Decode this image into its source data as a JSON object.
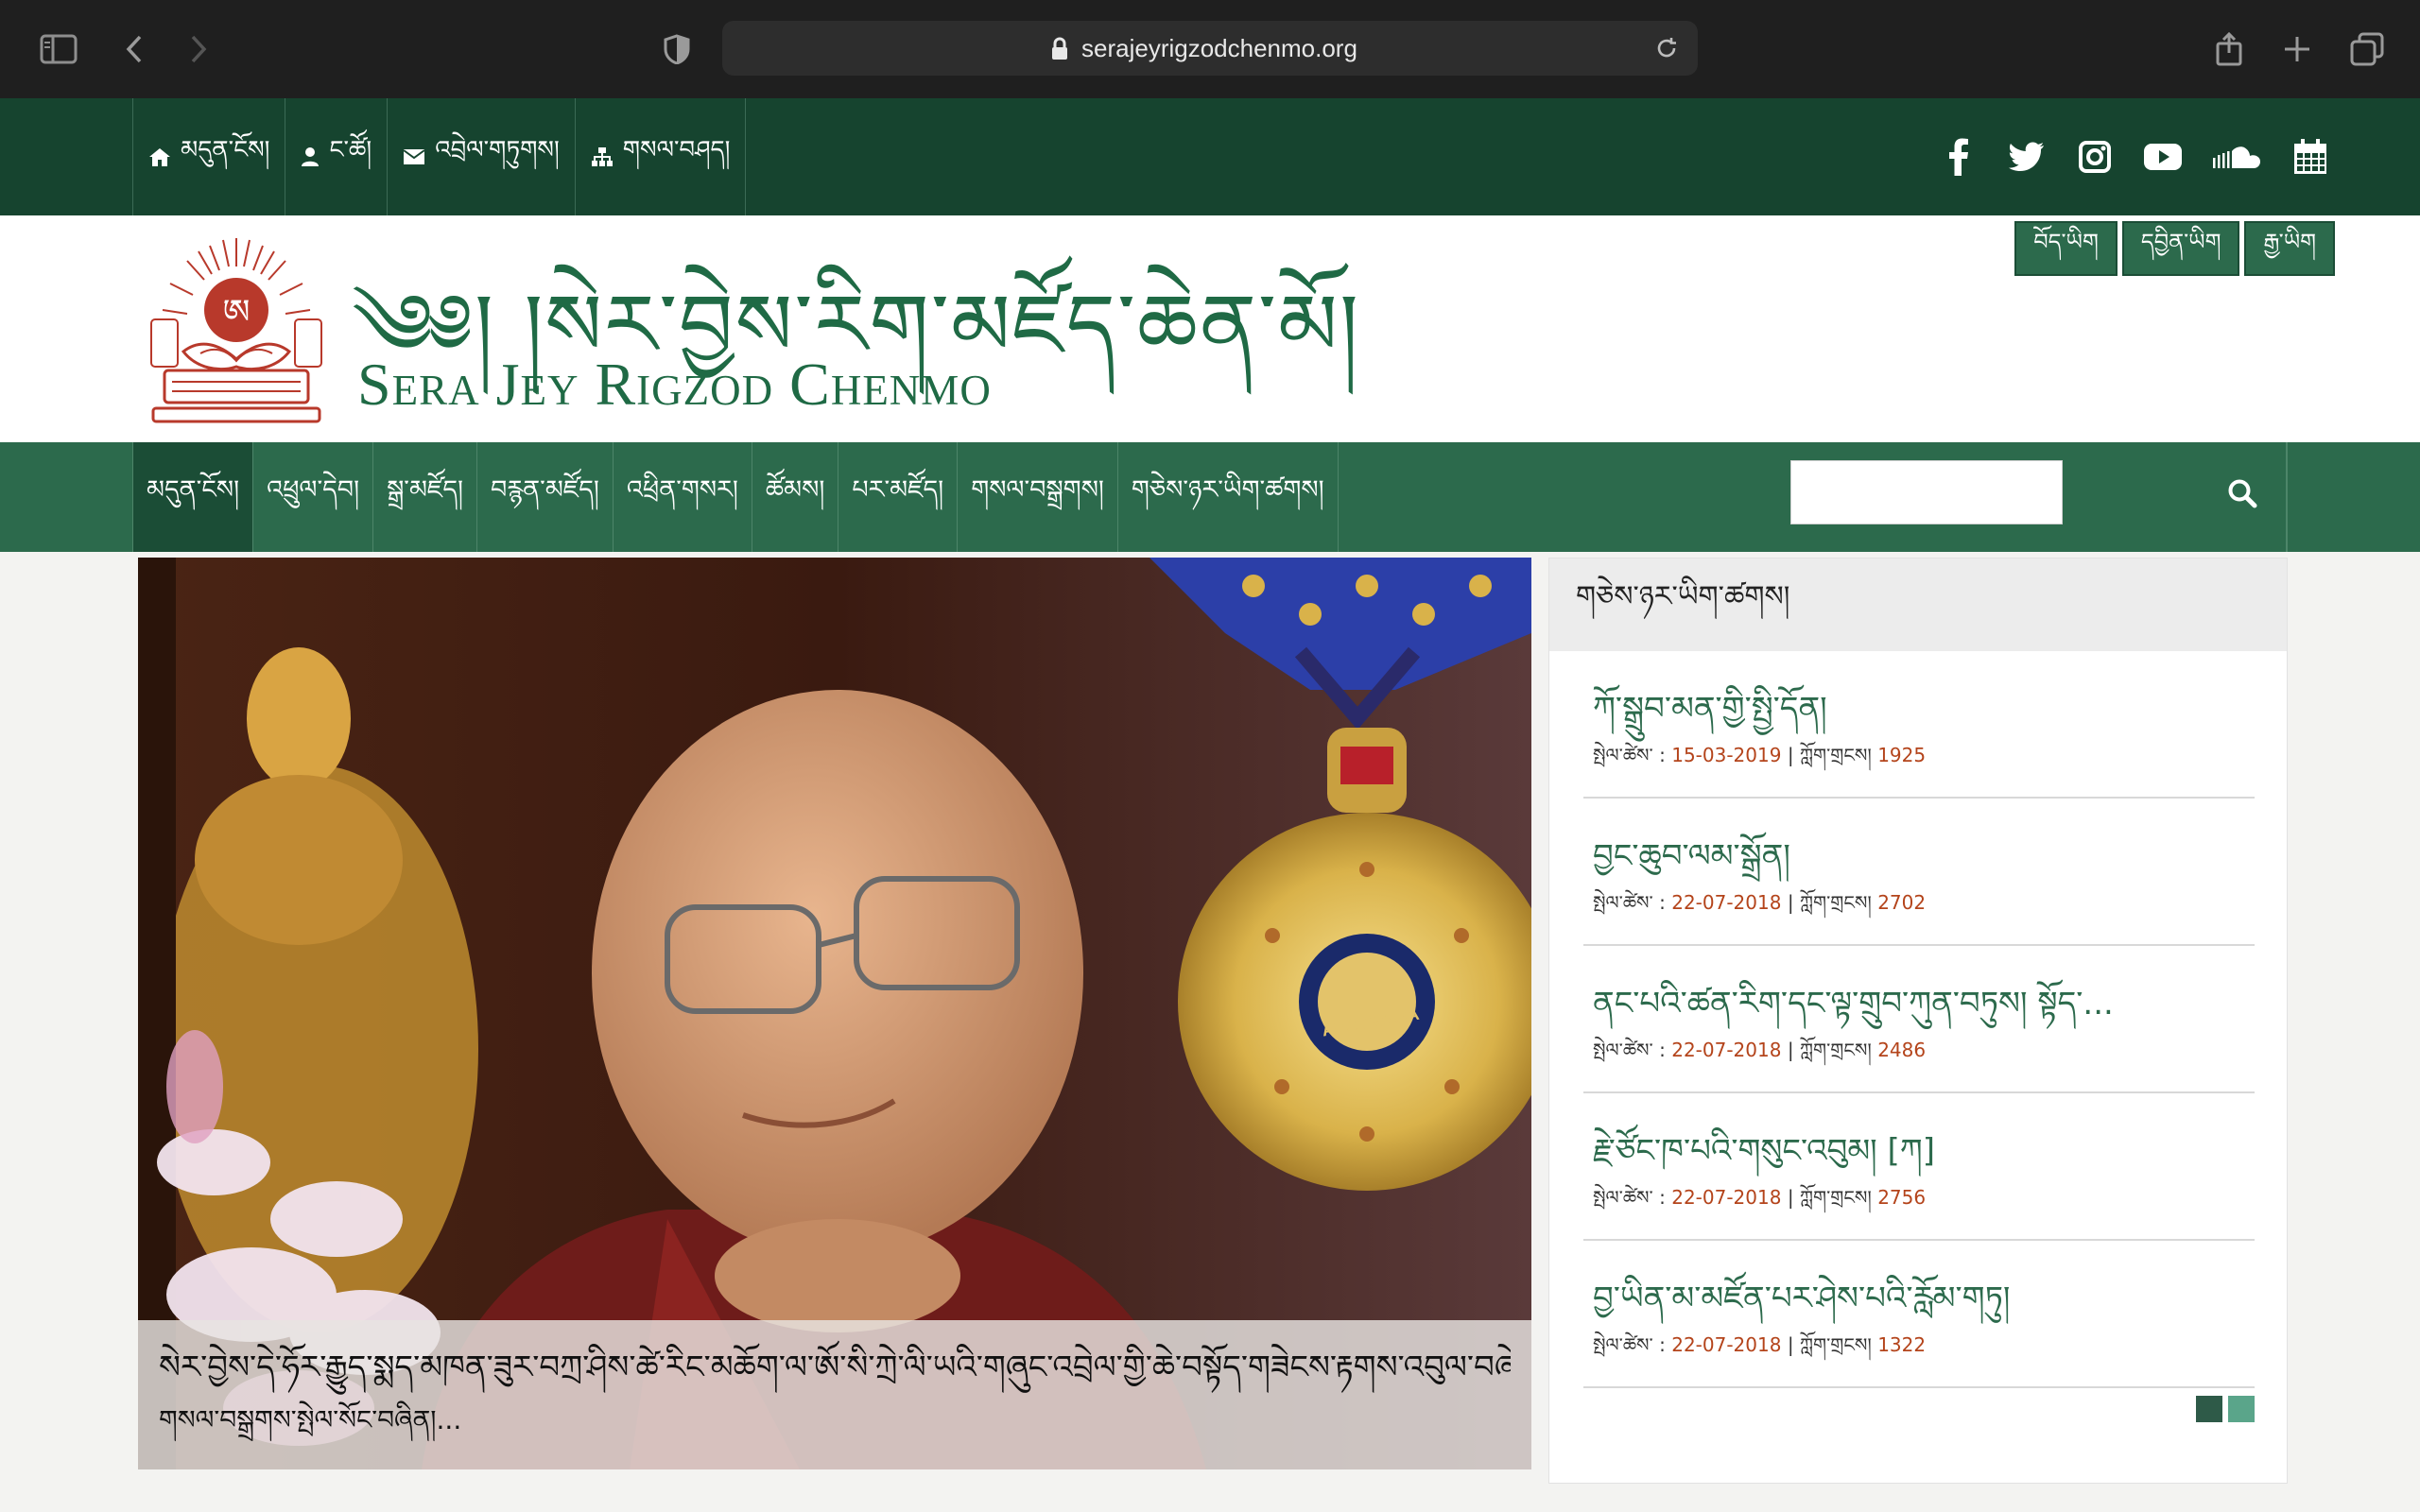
{
  "browser": {
    "url": "serajeyrigzodchenmo.org"
  },
  "topbar": {
    "links": [
      {
        "label": "མདུན་ངོས།",
        "icon": "home-icon"
      },
      {
        "label": "ང་ཚོ།",
        "icon": "user-icon"
      },
      {
        "label": "འབྲེལ་གཏུགས།",
        "icon": "envelope-icon"
      },
      {
        "label": "གསལ་བཤད།",
        "icon": "sitemap-icon"
      }
    ],
    "social": [
      "facebook-icon",
      "twitter-icon",
      "instagram-icon",
      "youtube-icon",
      "soundcloud-icon",
      "calendar-icon"
    ]
  },
  "header": {
    "title_tibetan": "༄༅། །སེར་བྱེས་རིག་མཛོད་ཆེན་མོ།",
    "title_english": "Sera Jey Rigzod Chenmo",
    "languages": [
      "བོད་ཡིག",
      "དབྱིན་ཡིག",
      "རྒྱ་ཡིག"
    ]
  },
  "mainnav": {
    "items": [
      "མདུན་ངོས།",
      "འཕྲུལ་དེབ།",
      "སྒྲ་མཛོད།",
      "བརྙན་མཛོད།",
      "འཕྲིན་གསར།",
      "ཚོམས།",
      "པར་མཛོད།",
      "གསལ་བསྒྲགས།",
      "གཅེས་ཉར་ཡིག་ཚགས།"
    ],
    "search_placeholder": ""
  },
  "slider": {
    "caption_line1": "སེར་བྱེས་དེ་ཧོར་རྒྱུད་སྨད་མཁན་ཟུར་བཀྲ་ཤིས་ཚེ་རིང་མཆོག་ལ་ཨོ་སི་ཀྲེ་ལི་ཡའི་གཞུང་འབྲེལ་གྱི་ཆེ་བསྟོད་གཟེངས་རྟགས་འབུལ་བཞེས་མཛད་",
    "caption_line2": "གསལ་བསྒྲགས་སྤེལ་སོང་བཞིན།..."
  },
  "sidebar": {
    "heading": "གཅེས་ཉར་ཡིག་ཚགས།",
    "date_label": "སྤེལ་ཚེས་ :",
    "views_label": "| ཀློག་གྲངས།",
    "posts": [
      {
        "title": "ཀོ་སྒྲུབ་མན་གྱི་སྤྱི་དོན།",
        "date": "15-03-2019",
        "views": "1925"
      },
      {
        "title": "བྱང་ཆུབ་ལམ་སྒྲོན།",
        "date": "22-07-2018",
        "views": "2702"
      },
      {
        "title": "ནང་པའི་ཚན་རིག་དང་ལྟ་གྲུབ་ཀུན་བཏུས། སྟོད་...",
        "date": "22-07-2018",
        "views": "2486"
      },
      {
        "title": "རྗེ་ཙོང་ཁ་པའི་གསུང་འབུམ། [ཀ]",
        "date": "22-07-2018",
        "views": "2756"
      },
      {
        "title": "བྱ་ཡིན་མ་མཛོན་པར་ཤེས་པའི་རློམ་གཏུ།",
        "date": "22-07-2018",
        "views": "1322"
      }
    ]
  },
  "colors": {
    "topbar": "#16442f",
    "nav": "#2c6a4c",
    "accent_date": "#b4441b"
  }
}
